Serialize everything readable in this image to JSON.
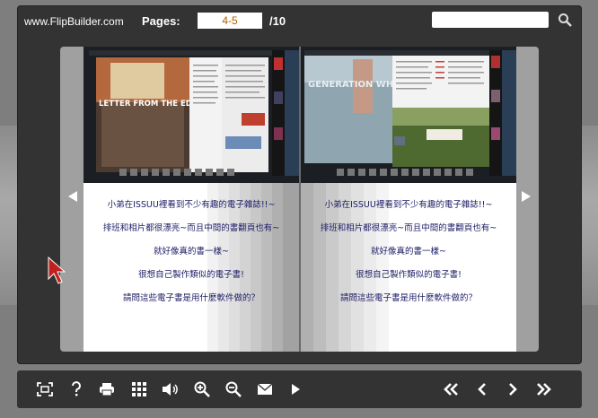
{
  "header": {
    "brand": "www.FlipBuilder.com",
    "pages_label": "Pages:",
    "page_value": "4-5",
    "total_pages": "/10",
    "search_value": ""
  },
  "book": {
    "left_page": {
      "lines": [
        "小弟在ISSUU裡看到不少有趣的電子雜誌!!~",
        "排班和相片都很漂亮~而且中間的書翻頁也有~",
        "就好像真的書一樣~",
        "很想自己製作類似的電子書!",
        "請問這些電子書是用什麼軟件做的？"
      ],
      "screenshot_title": "LETTER FROM THE EDITOR"
    },
    "right_page": {
      "lines": [
        "小弟在ISSUU裡看到不少有趣的電子雜誌!!~",
        "排班和相片都很漂亮~而且中間的書翻頁也有~",
        "就好像真的書一樣~",
        "很想自己製作類似的電子書!",
        "請問這些電子書是用什麼軟件做的？"
      ],
      "screenshot_title": "GENERATION WHY"
    }
  },
  "toolbar": {
    "icons": [
      "fullscreen-icon",
      "help-icon",
      "print-icon",
      "thumbnails-icon",
      "sound-icon",
      "zoom-in-icon",
      "zoom-out-icon",
      "email-icon",
      "autoplay-icon",
      "first-page-icon",
      "previous-page-icon",
      "next-page-icon",
      "last-page-icon"
    ]
  },
  "colors": {
    "frame": "#333333",
    "page_text": "#1c1c66",
    "page_number": "#b06000"
  }
}
